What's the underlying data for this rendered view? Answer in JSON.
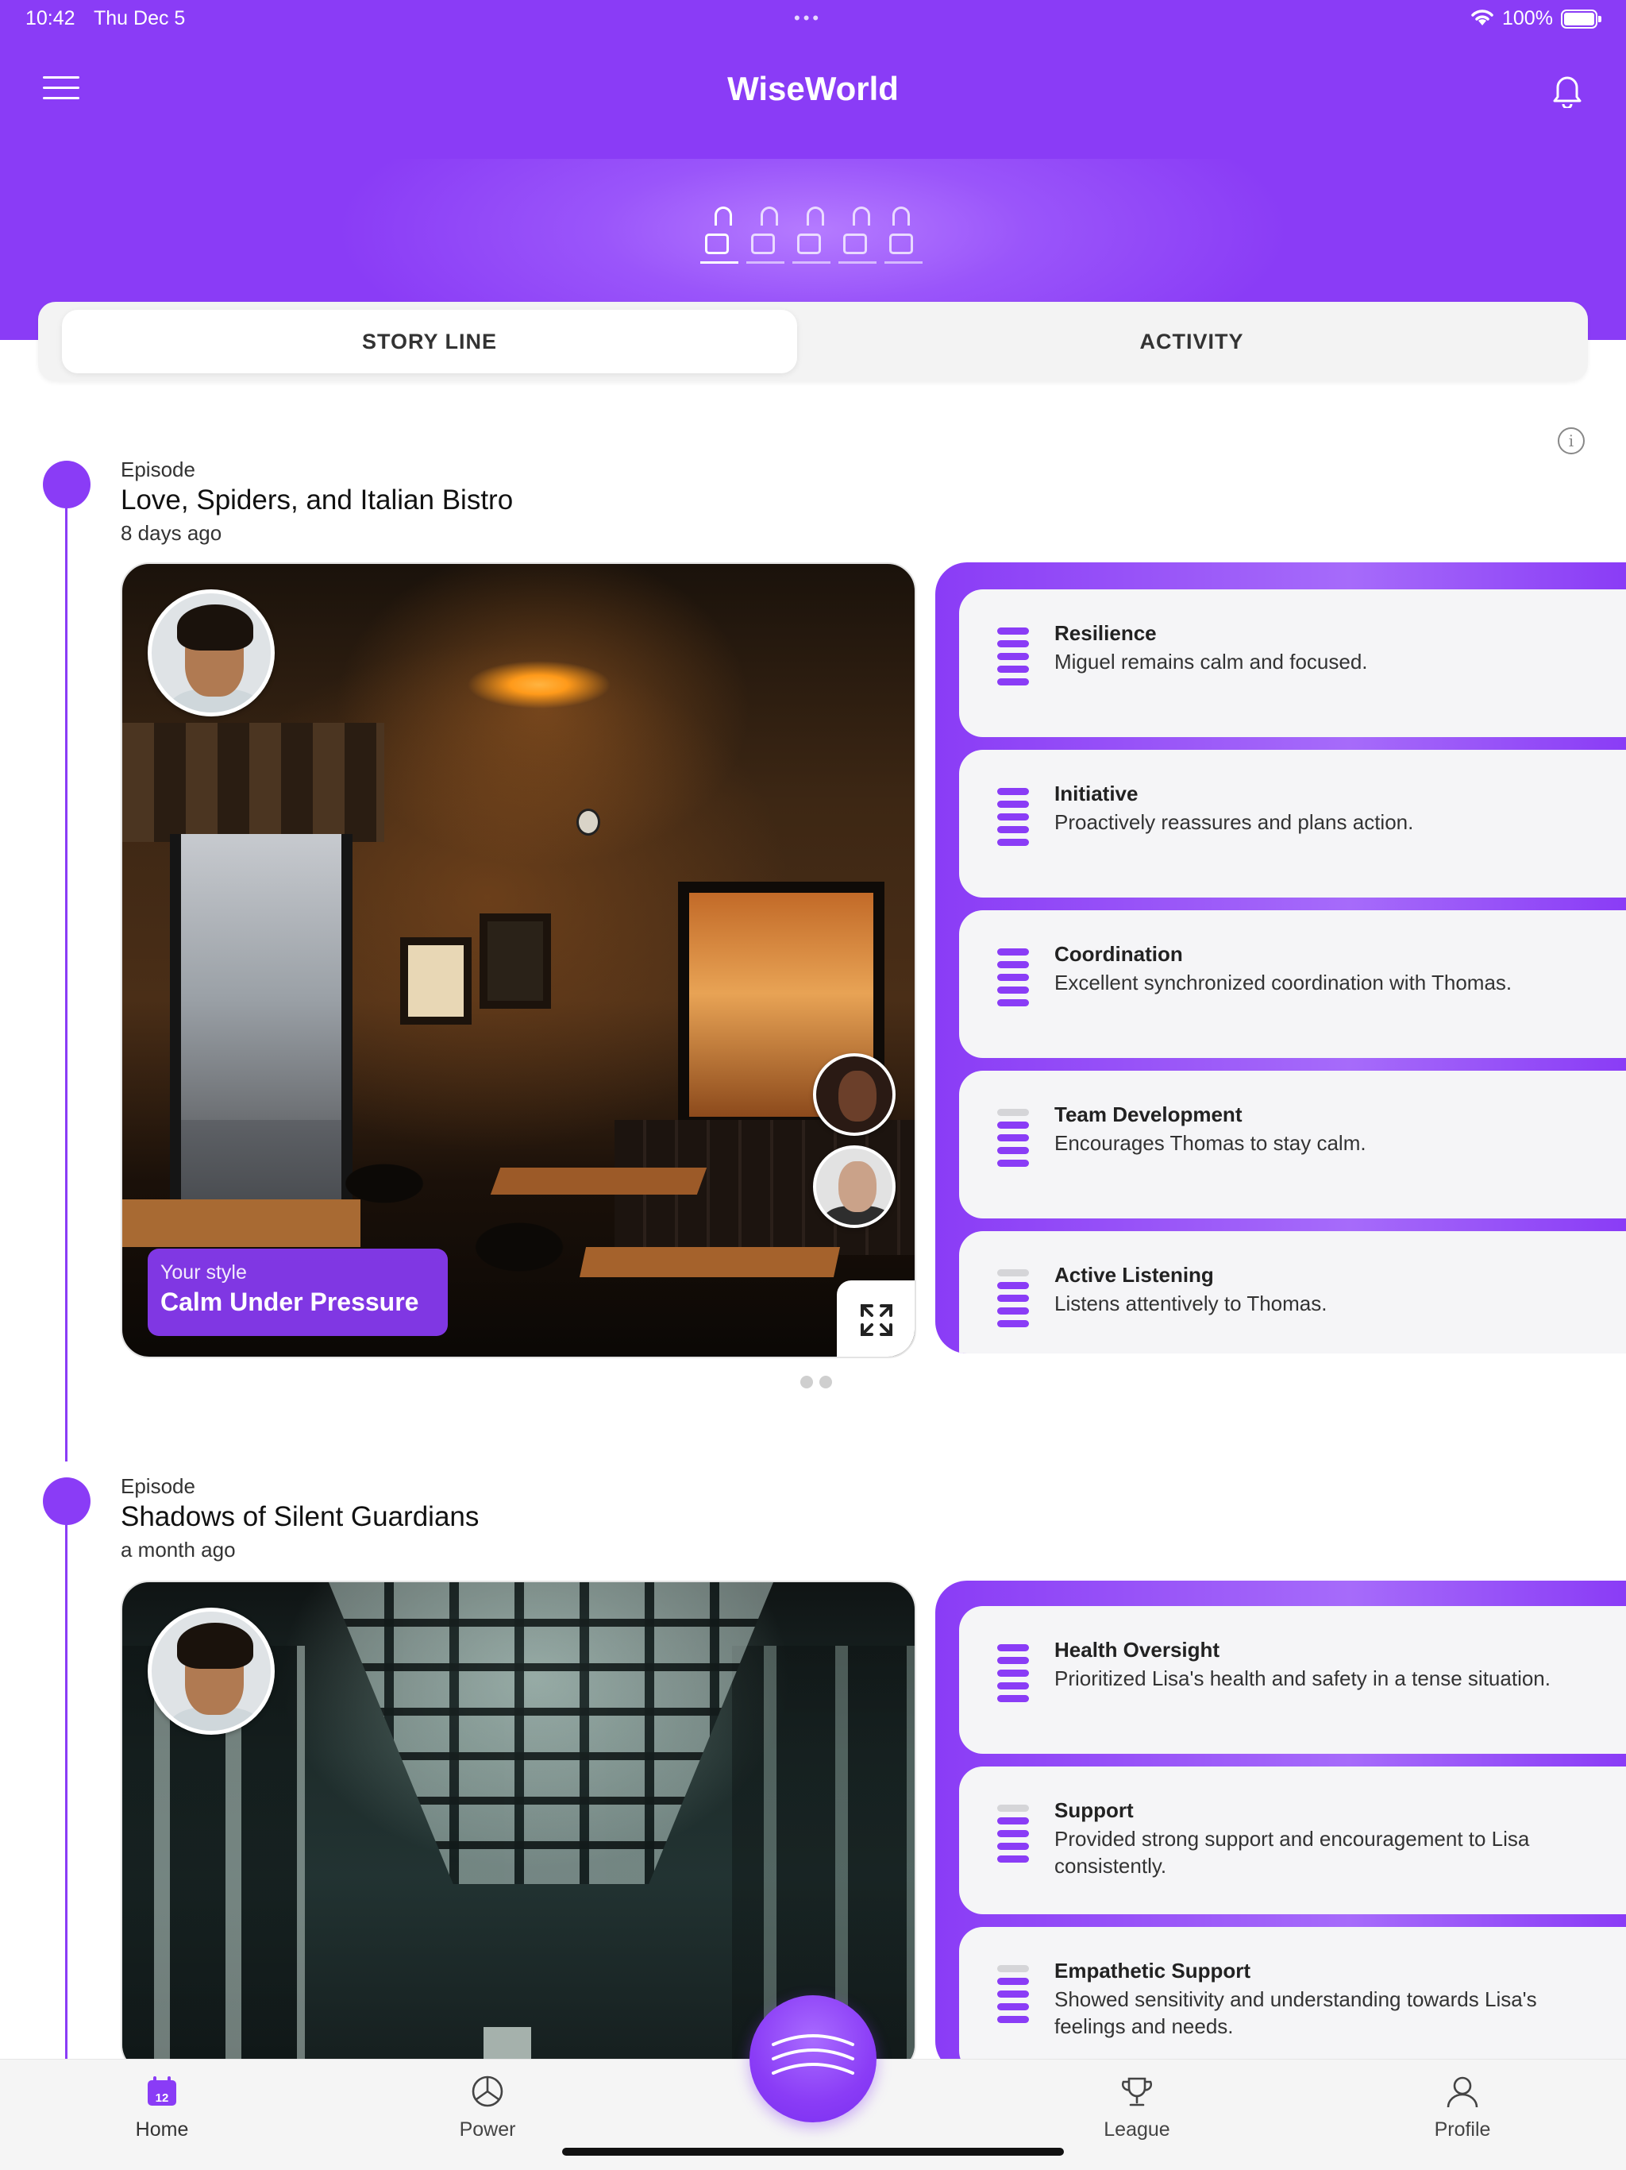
{
  "status_bar": {
    "time": "10:42",
    "date": "Thu Dec 5",
    "battery": "100%"
  },
  "header": {
    "title": "WiseWorld",
    "levels": {
      "total": 5,
      "unlocked": 4
    }
  },
  "tabs": [
    {
      "label": "STORY LINE",
      "active": true
    },
    {
      "label": "ACTIVITY",
      "active": false
    }
  ],
  "episodes": [
    {
      "label": "Episode",
      "title": "Love, Spiders, and Italian Bistro",
      "time": "8 days ago",
      "style_label": "Your style",
      "style_value": "Calm Under Pressure",
      "skills": [
        {
          "name": "Resilience",
          "description": "Miguel remains calm and focused.",
          "level": 5
        },
        {
          "name": "Initiative",
          "description": "Proactively reassures and plans action.",
          "level": 5
        },
        {
          "name": "Coordination",
          "description": "Excellent synchronized coordination with Thomas.",
          "level": 5
        },
        {
          "name": "Team Development",
          "description": "Encourages Thomas to stay calm.",
          "level": 4
        },
        {
          "name": "Active Listening",
          "description": "Listens attentively to Thomas.",
          "level": 4
        }
      ]
    },
    {
      "label": "Episode",
      "title": "Shadows of Silent Guardians",
      "time": "a month ago",
      "skills": [
        {
          "name": "Health Oversight",
          "description": "Prioritized Lisa's health and safety in a tense situation.",
          "level": 5
        },
        {
          "name": "Support",
          "description": "Provided strong support and encouragement to Lisa consistently.",
          "level": 4
        },
        {
          "name": "Empathetic Support",
          "description": "Showed sensitivity and understanding towards Lisa's feelings and needs.",
          "level": 4
        }
      ]
    }
  ],
  "bottom_nav": {
    "home": {
      "label": "Home",
      "badge": "12"
    },
    "power": {
      "label": "Power"
    },
    "league": {
      "label": "League"
    },
    "profile": {
      "label": "Profile"
    }
  },
  "colors": {
    "accent": "#8a3cf6",
    "card_bg": "#f5f5f7"
  }
}
